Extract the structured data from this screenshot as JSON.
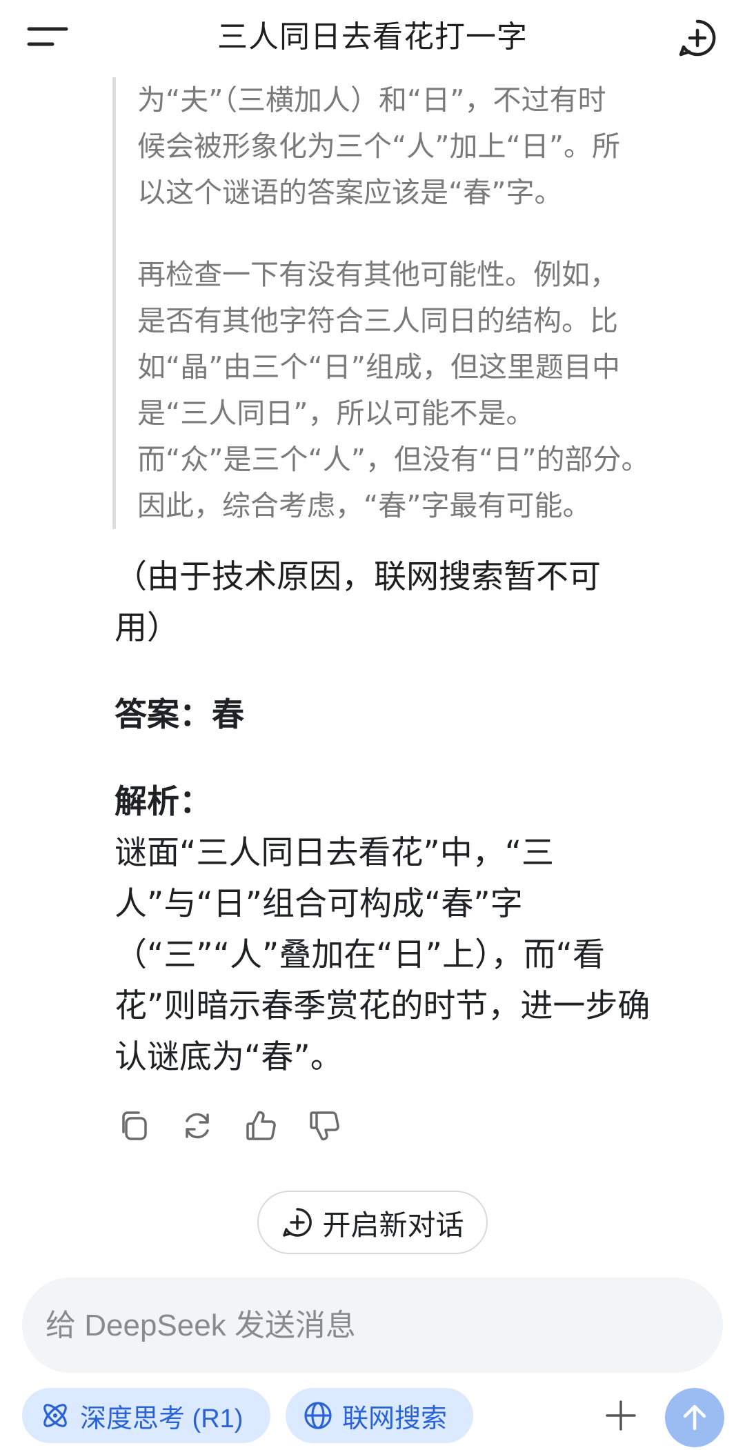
{
  "header": {
    "title": "三人同日去看花打一字",
    "menu_icon": "menu-icon",
    "new_chat_icon": "plus-circle-icon"
  },
  "thinking": {
    "paragraphs": [
      "为“夫”（三横加人）和“日”，不过有时\n候会被形象化为三个“人”加上“日”。所\n以这个谜语的答案应该是“春”字。",
      "再检查一下有没有其他可能性。例如，\n是否有其他字符合三人同日的结构。比\n如“晶”由三个“日”组成，但这里题目中\n是“三人同日”，所以可能不是。\n而“众”是三个“人”，但没有“日”的部分。\n因此，综合考虑，“春”字最有可能。"
    ]
  },
  "answer": {
    "note": "（由于技术原因，联网搜索暂不可\n用）",
    "result": "答案：春",
    "analysis_title": "解析：",
    "analysis_body": "谜面“三人同日去看花”中，“三\n人”与“日”组合可构成“春”字\n（“三”“人”叠加在“日”上），而“看\n花”则暗示春季赏花的时节，进一步确\n认谜底为“春”。"
  },
  "actions": {
    "icons": [
      "copy-icon",
      "regenerate-icon",
      "thumbs-up-icon",
      "thumbs-down-icon"
    ]
  },
  "new_conversation": {
    "label": "开启新对话"
  },
  "composer": {
    "placeholder": "给 DeepSeek 发送消息",
    "deep_think_label": "深度思考 (R1)",
    "web_search_label": "联网搜索"
  },
  "colors": {
    "accent": "#2a62d8",
    "chip_bg": "#dbeafe",
    "send_bg": "#9bbcf2",
    "think_text": "#7a7a7a",
    "input_bg": "#f3f4f6"
  }
}
